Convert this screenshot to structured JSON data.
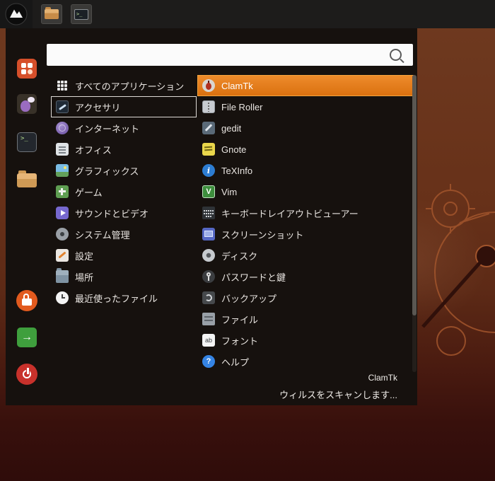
{
  "colors": {
    "highlight": "#e07b22",
    "highlight_border": "#f4a53e",
    "panel_bg": "#16110e",
    "taskbar_bg": "#1d1c1b",
    "desktop_top": "#6f3a20",
    "desktop_bottom": "#2f0c0a"
  },
  "taskbar": {
    "buttons": [
      {
        "name": "file-manager"
      },
      {
        "name": "terminal",
        "glyph": ">_"
      }
    ]
  },
  "menu": {
    "search": {
      "value": "",
      "placeholder": ""
    },
    "favorites": [
      {
        "name": "software-center"
      },
      {
        "name": "messenger"
      },
      {
        "name": "terminal",
        "glyph": ">_"
      },
      {
        "name": "file-manager"
      },
      {
        "name": "lock-screen"
      },
      {
        "name": "log-out",
        "glyph": "→"
      },
      {
        "name": "shut-down"
      }
    ],
    "categories": [
      {
        "label": "すべてのアプリケーション"
      },
      {
        "label": "アクセサリ",
        "focused": true
      },
      {
        "label": "インターネット"
      },
      {
        "label": "オフィス"
      },
      {
        "label": "グラフィックス"
      },
      {
        "label": "ゲーム"
      },
      {
        "label": "サウンドとビデオ"
      },
      {
        "label": "システム管理"
      },
      {
        "label": "設定"
      },
      {
        "label": "場所"
      },
      {
        "label": "最近使ったファイル"
      }
    ],
    "apps": [
      {
        "label": "ClamTk",
        "selected": true
      },
      {
        "label": "File Roller"
      },
      {
        "label": "gedit"
      },
      {
        "label": "Gnote"
      },
      {
        "label": "TeXInfo",
        "glyph": "i"
      },
      {
        "label": "Vim",
        "glyph": "V"
      },
      {
        "label": "キーボードレイアウトビューアー"
      },
      {
        "label": "スクリーンショット"
      },
      {
        "label": "ディスク"
      },
      {
        "label": "パスワードと鍵"
      },
      {
        "label": "バックアップ"
      },
      {
        "label": "ファイル"
      },
      {
        "label": "フォント",
        "glyph": "ab"
      },
      {
        "label": "ヘルプ",
        "glyph": "?"
      }
    ],
    "status": {
      "app_name": "ClamTk",
      "app_description": "ウィルスをスキャンします..."
    }
  }
}
